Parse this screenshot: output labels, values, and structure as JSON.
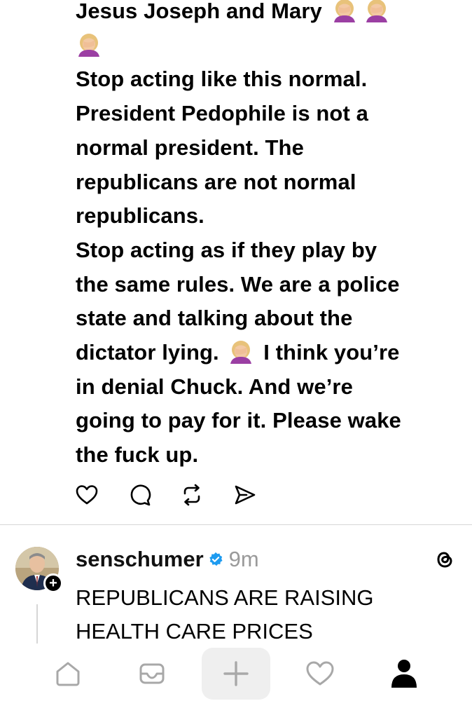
{
  "post": {
    "lines": [
      "Jesus Joseph and Mary",
      "",
      "Stop acting like this normal.",
      "President Pedophile is not a",
      "normal president. The",
      "republicans are not normal",
      "republicans.",
      "Stop acting as if they play by",
      "the same rules. We are a police",
      "state and talking about the",
      "dictator lying.",
      "I think you’re",
      "in denial Chuck. And we’re",
      "going to pay for it. Please wake",
      "the fuck up."
    ],
    "emoji_icon": "woman-facepalming-emoji"
  },
  "actions": [
    "heart-icon",
    "comment-icon",
    "repost-icon",
    "share-icon"
  ],
  "reply": {
    "username": "senschumer",
    "time": "9m",
    "lines": [
      "REPUBLICANS ARE RAISING",
      "HEALTH CARE PRICES"
    ],
    "verified_color": "#1d9bf0"
  },
  "tabbar": [
    "home-icon",
    "inbox-icon",
    "create-icon",
    "activity-icon",
    "profile-icon"
  ]
}
